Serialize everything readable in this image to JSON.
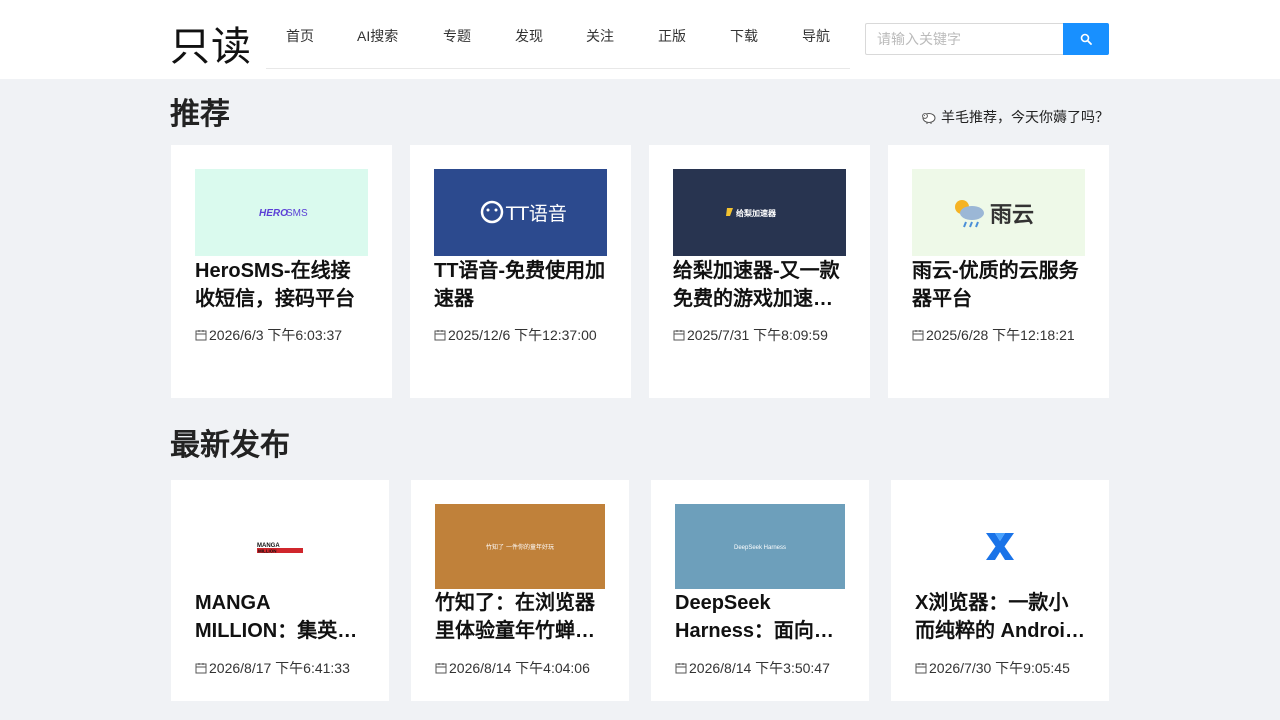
{
  "header": {
    "logo": "只读",
    "nav": [
      "首页",
      "AI搜索",
      "专题",
      "发现",
      "关注",
      "正版",
      "下载",
      "导航"
    ],
    "search_placeholder": "请输入关键字"
  },
  "recommend": {
    "title": "推荐",
    "promo": "羊毛推荐，今天你薅了吗？",
    "cards": [
      {
        "thumb_text": "HEROSMS",
        "thumb_bg": "#dafaee",
        "title": "HeroSMS-在线接收短信，接码平台",
        "date": "2026/6/3 下午6:03:37"
      },
      {
        "thumb_text": "TT语音",
        "thumb_bg": "#2c4a8e",
        "title": "TT语音-免费使用加速器",
        "date": "2025/12/6 下午12:37:00"
      },
      {
        "thumb_text": "给梨加速器",
        "thumb_bg": "#283450",
        "title": "给梨加速器-又一款免费的游戏加速…",
        "date": "2025/7/31 下午8:09:59"
      },
      {
        "thumb_text": "雨云",
        "thumb_bg": "#eef9e8",
        "title": "雨云-优质的云服务器平台",
        "date": "2025/6/28 下午12:18:21"
      }
    ]
  },
  "latest": {
    "title": "最新发布",
    "cards": [
      {
        "thumb_text": "MANGA MILLION",
        "thumb_bg": "#ffffff",
        "title": "MANGA MILLION：集英…",
        "date": "2026/8/17 下午6:41:33"
      },
      {
        "thumb_text": "竹知了 一件你的童年好玩",
        "thumb_bg": "#c0813a",
        "title": "竹知了：在浏览器里体验童年竹蝉…",
        "date": "2026/8/14 下午4:04:06"
      },
      {
        "thumb_text": "DeepSeek Harness",
        "thumb_bg": "#6d9fbb",
        "title": "DeepSeek Harness：面向…",
        "date": "2026/8/14 下午3:50:47"
      },
      {
        "thumb_text": "X",
        "thumb_bg": "#ffffff",
        "title": "X浏览器：一款小而纯粹的 Androi…",
        "date": "2026/7/30 下午9:05:45"
      }
    ]
  }
}
